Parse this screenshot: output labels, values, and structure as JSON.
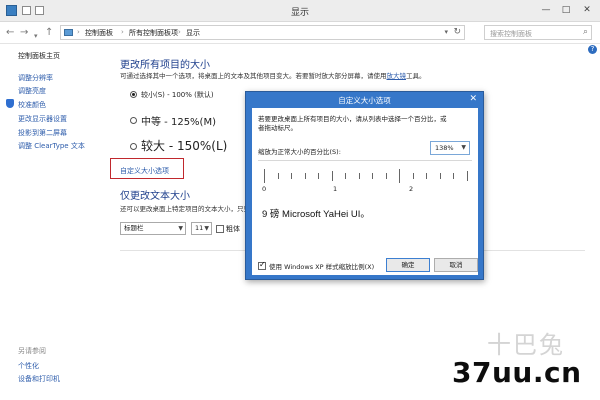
{
  "window": {
    "title": "显示",
    "controls": {
      "minimize": "—",
      "maximize": "□",
      "close": "✕"
    }
  },
  "address_bar": {
    "back": "←",
    "forward": "→",
    "up": "↑",
    "crumbs": [
      "控制面板",
      "所有控制面板项",
      "显示"
    ],
    "separator": "›",
    "search_placeholder": "搜索控制面板"
  },
  "help_icon": "?",
  "left_pane": {
    "home": "控制面板主页",
    "links": [
      "调整分辨率",
      "调整亮度",
      "校准颜色",
      "更改显示器设置",
      "投影到第二屏幕",
      "调整 ClearType 文本"
    ],
    "see_also": "另请参阅",
    "see_also_links": [
      "个性化",
      "设备和打印机"
    ]
  },
  "main": {
    "title": "更改所有项目的大小",
    "description_prefix": "可通过选择其中一个选项，将桌面上的文本及其他项目变大。若要暂时放大部分屏幕，请使用",
    "description_link": "放大镜",
    "description_suffix": "工具。",
    "options": [
      {
        "label": "较小(S) - 100% (默认)",
        "selected": true
      },
      {
        "label": "中等 - 125%(M)",
        "selected": false
      },
      {
        "label": "较大 - 150%(L)",
        "selected": false
      }
    ],
    "custom_link": "自定义大小选项",
    "text_only_title": "仅更改文本大小",
    "text_only_desc": "还可以更改桌面上特定项目的文本大小，只更",
    "item_select": "标题栏",
    "size_select": "11",
    "bold_label": "粗体"
  },
  "dialog": {
    "title": "自定义大小选项",
    "close": "✕",
    "description": "若要更改桌面上所有项目的大小，请从列表中选择一个百分比，或者拖动标尺。",
    "scale_label": "缩放为正常大小的百分比(S):",
    "scale_value": "138%",
    "ruler_numbers": [
      "0",
      "1",
      "2"
    ],
    "sample_text": "9 磅 Microsoft YaHei UI。",
    "xp_scaling_label": "使用 Windows XP 样式缩放比例(X)",
    "xp_scaling_checked": true,
    "ok": "确定",
    "cancel": "取消"
  },
  "watermarks": {
    "logo": "十巴兔",
    "site": "37uu.cn"
  },
  "colors": {
    "accent_blue": "#3677c9",
    "heading_blue": "#1e3f8c",
    "link_blue": "#2d5cab",
    "highlight_red": "#c0282d"
  }
}
